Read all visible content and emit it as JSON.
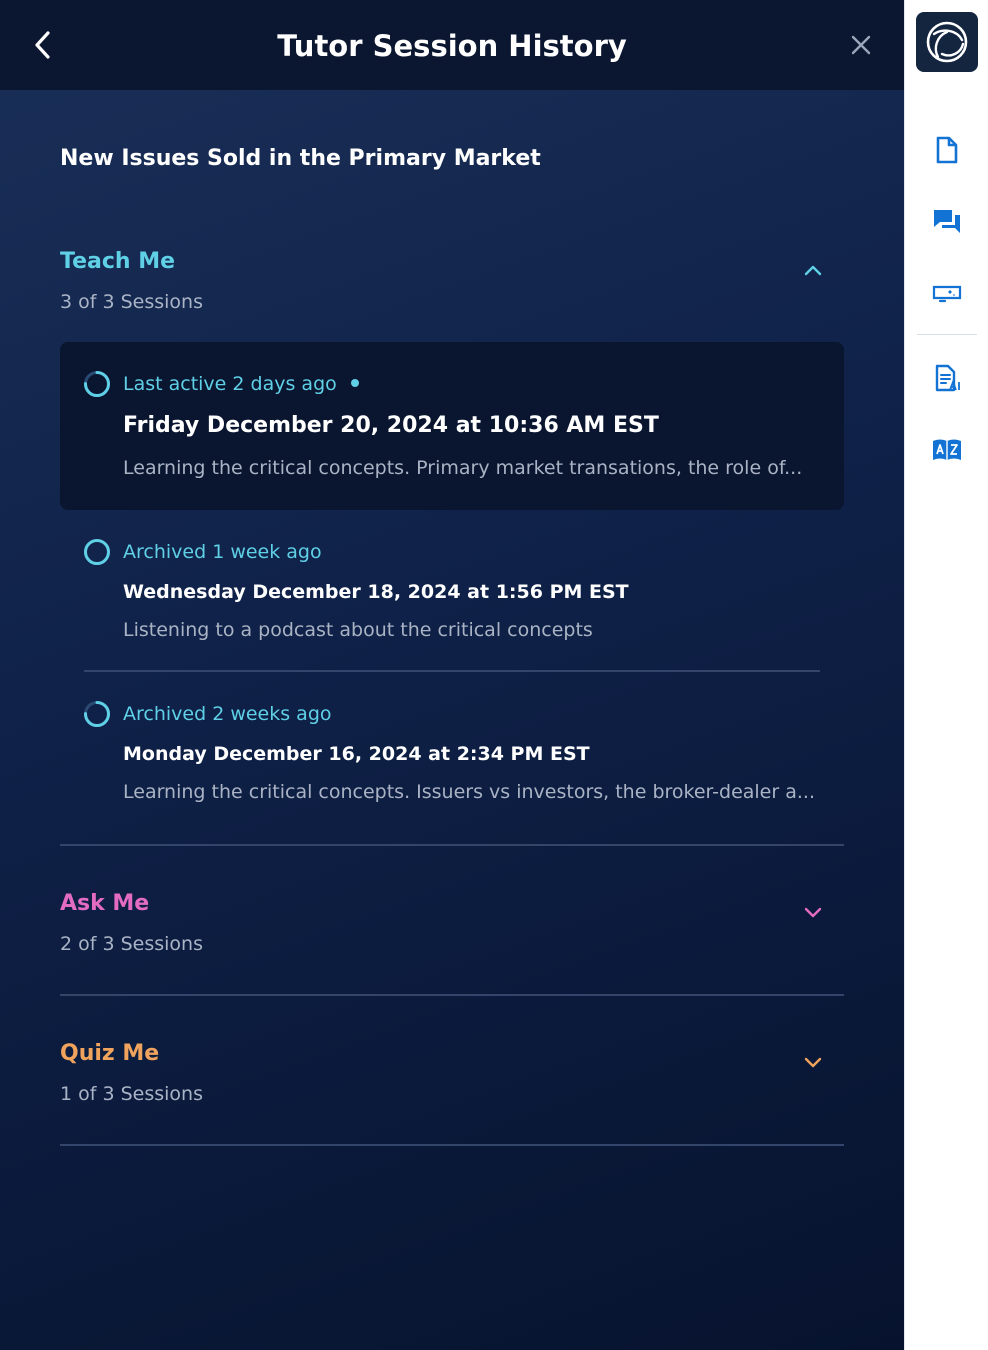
{
  "header": {
    "title": "Tutor Session History"
  },
  "topic": {
    "title": "New Issues Sold in the Primary Market"
  },
  "sections": [
    {
      "name": "Teach Me",
      "count": "3 of 3 Sessions",
      "color": "#5fd0e6",
      "expanded": true,
      "sessions": [
        {
          "status": "Last active 2 days ago",
          "date": "Friday December 20, 2024 at 10:36 AM EST",
          "description": "Learning the critical concepts. Primary market transations, the role of...",
          "progress": 0.75,
          "active": true
        },
        {
          "status": "Archived 1 week ago",
          "date": "Wednesday December 18, 2024 at 1:56 PM EST",
          "description": "Listening to a podcast about the critical concepts",
          "progress": 1.0,
          "active": false
        },
        {
          "status": "Archived 2 weeks ago",
          "date": "Monday December 16, 2024 at 2:34 PM EST",
          "description": "Learning the critical concepts. Issuers vs investors, the broker-dealer a...",
          "progress": 0.75,
          "active": false
        }
      ]
    },
    {
      "name": "Ask Me",
      "count": "2 of 3 Sessions",
      "color": "#e46bc2",
      "expanded": false
    },
    {
      "name": "Quiz Me",
      "count": "1 of 3 Sessions",
      "color": "#f0a35c",
      "expanded": false
    }
  ],
  "rail": {
    "accent": "#1273d4",
    "items": [
      "document-icon",
      "chat-icon",
      "ai-screen-icon",
      "ai-document-icon",
      "dictionary-icon"
    ]
  }
}
